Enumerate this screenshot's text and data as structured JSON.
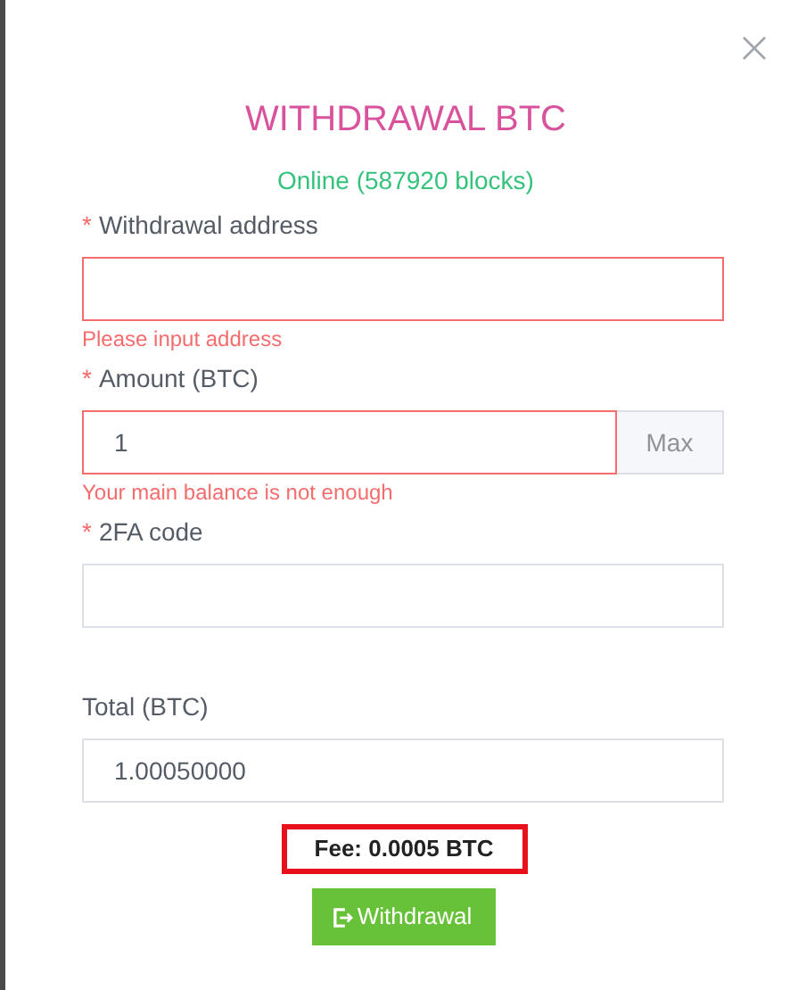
{
  "dialog": {
    "title": "WITHDRAWAL BTC",
    "status": "Online (587920 blocks)",
    "fields": [
      {
        "label": "Withdrawal address",
        "required_mark": "*",
        "invalid": true,
        "error": "Please input address"
      },
      {
        "label": "Amount (BTC)",
        "required_mark": "*",
        "value": "1",
        "invalid": true,
        "error": "Your main balance is not enough",
        "addon": "Max"
      },
      {
        "label": "2FA code",
        "required_mark": "*",
        "invalid": false
      },
      {
        "label": "Total (BTC)",
        "value": "1.00050000",
        "invalid": false
      }
    ],
    "fee": "Fee: 0.0005 BTC",
    "submit": "Withdrawal"
  }
}
